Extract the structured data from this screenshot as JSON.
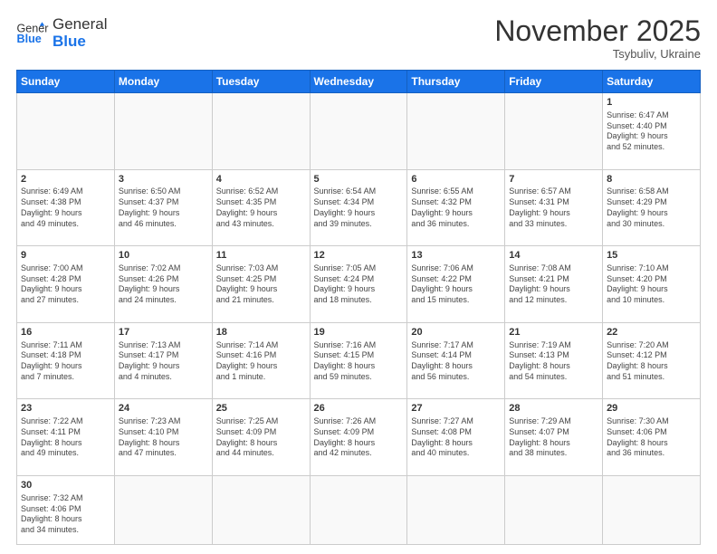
{
  "header": {
    "logo_general": "General",
    "logo_blue": "Blue",
    "month": "November 2025",
    "location": "Tsybuliv, Ukraine"
  },
  "weekdays": [
    "Sunday",
    "Monday",
    "Tuesday",
    "Wednesday",
    "Thursday",
    "Friday",
    "Saturday"
  ],
  "weeks": [
    [
      {
        "day": "",
        "info": ""
      },
      {
        "day": "",
        "info": ""
      },
      {
        "day": "",
        "info": ""
      },
      {
        "day": "",
        "info": ""
      },
      {
        "day": "",
        "info": ""
      },
      {
        "day": "",
        "info": ""
      },
      {
        "day": "1",
        "info": "Sunrise: 6:47 AM\nSunset: 4:40 PM\nDaylight: 9 hours\nand 52 minutes."
      }
    ],
    [
      {
        "day": "2",
        "info": "Sunrise: 6:49 AM\nSunset: 4:38 PM\nDaylight: 9 hours\nand 49 minutes."
      },
      {
        "day": "3",
        "info": "Sunrise: 6:50 AM\nSunset: 4:37 PM\nDaylight: 9 hours\nand 46 minutes."
      },
      {
        "day": "4",
        "info": "Sunrise: 6:52 AM\nSunset: 4:35 PM\nDaylight: 9 hours\nand 43 minutes."
      },
      {
        "day": "5",
        "info": "Sunrise: 6:54 AM\nSunset: 4:34 PM\nDaylight: 9 hours\nand 39 minutes."
      },
      {
        "day": "6",
        "info": "Sunrise: 6:55 AM\nSunset: 4:32 PM\nDaylight: 9 hours\nand 36 minutes."
      },
      {
        "day": "7",
        "info": "Sunrise: 6:57 AM\nSunset: 4:31 PM\nDaylight: 9 hours\nand 33 minutes."
      },
      {
        "day": "8",
        "info": "Sunrise: 6:58 AM\nSunset: 4:29 PM\nDaylight: 9 hours\nand 30 minutes."
      }
    ],
    [
      {
        "day": "9",
        "info": "Sunrise: 7:00 AM\nSunset: 4:28 PM\nDaylight: 9 hours\nand 27 minutes."
      },
      {
        "day": "10",
        "info": "Sunrise: 7:02 AM\nSunset: 4:26 PM\nDaylight: 9 hours\nand 24 minutes."
      },
      {
        "day": "11",
        "info": "Sunrise: 7:03 AM\nSunset: 4:25 PM\nDaylight: 9 hours\nand 21 minutes."
      },
      {
        "day": "12",
        "info": "Sunrise: 7:05 AM\nSunset: 4:24 PM\nDaylight: 9 hours\nand 18 minutes."
      },
      {
        "day": "13",
        "info": "Sunrise: 7:06 AM\nSunset: 4:22 PM\nDaylight: 9 hours\nand 15 minutes."
      },
      {
        "day": "14",
        "info": "Sunrise: 7:08 AM\nSunset: 4:21 PM\nDaylight: 9 hours\nand 12 minutes."
      },
      {
        "day": "15",
        "info": "Sunrise: 7:10 AM\nSunset: 4:20 PM\nDaylight: 9 hours\nand 10 minutes."
      }
    ],
    [
      {
        "day": "16",
        "info": "Sunrise: 7:11 AM\nSunset: 4:18 PM\nDaylight: 9 hours\nand 7 minutes."
      },
      {
        "day": "17",
        "info": "Sunrise: 7:13 AM\nSunset: 4:17 PM\nDaylight: 9 hours\nand 4 minutes."
      },
      {
        "day": "18",
        "info": "Sunrise: 7:14 AM\nSunset: 4:16 PM\nDaylight: 9 hours\nand 1 minute."
      },
      {
        "day": "19",
        "info": "Sunrise: 7:16 AM\nSunset: 4:15 PM\nDaylight: 8 hours\nand 59 minutes."
      },
      {
        "day": "20",
        "info": "Sunrise: 7:17 AM\nSunset: 4:14 PM\nDaylight: 8 hours\nand 56 minutes."
      },
      {
        "day": "21",
        "info": "Sunrise: 7:19 AM\nSunset: 4:13 PM\nDaylight: 8 hours\nand 54 minutes."
      },
      {
        "day": "22",
        "info": "Sunrise: 7:20 AM\nSunset: 4:12 PM\nDaylight: 8 hours\nand 51 minutes."
      }
    ],
    [
      {
        "day": "23",
        "info": "Sunrise: 7:22 AM\nSunset: 4:11 PM\nDaylight: 8 hours\nand 49 minutes."
      },
      {
        "day": "24",
        "info": "Sunrise: 7:23 AM\nSunset: 4:10 PM\nDaylight: 8 hours\nand 47 minutes."
      },
      {
        "day": "25",
        "info": "Sunrise: 7:25 AM\nSunset: 4:09 PM\nDaylight: 8 hours\nand 44 minutes."
      },
      {
        "day": "26",
        "info": "Sunrise: 7:26 AM\nSunset: 4:09 PM\nDaylight: 8 hours\nand 42 minutes."
      },
      {
        "day": "27",
        "info": "Sunrise: 7:27 AM\nSunset: 4:08 PM\nDaylight: 8 hours\nand 40 minutes."
      },
      {
        "day": "28",
        "info": "Sunrise: 7:29 AM\nSunset: 4:07 PM\nDaylight: 8 hours\nand 38 minutes."
      },
      {
        "day": "29",
        "info": "Sunrise: 7:30 AM\nSunset: 4:06 PM\nDaylight: 8 hours\nand 36 minutes."
      }
    ],
    [
      {
        "day": "30",
        "info": "Sunrise: 7:32 AM\nSunset: 4:06 PM\nDaylight: 8 hours\nand 34 minutes."
      },
      {
        "day": "",
        "info": ""
      },
      {
        "day": "",
        "info": ""
      },
      {
        "day": "",
        "info": ""
      },
      {
        "day": "",
        "info": ""
      },
      {
        "day": "",
        "info": ""
      },
      {
        "day": "",
        "info": ""
      }
    ]
  ]
}
